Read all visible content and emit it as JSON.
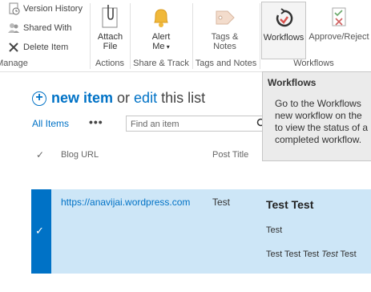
{
  "ribbon": {
    "small_buttons": {
      "version_history": "Version History",
      "shared_with": "Shared With",
      "delete_item": "Delete Item"
    },
    "groups": {
      "manage": "Manage",
      "actions": "Actions",
      "share_track": "Share & Track",
      "tags_notes": "Tags and Notes",
      "workflows": "Workflows"
    },
    "big_buttons": {
      "attach_file_line1": "Attach",
      "attach_file_line2": "File",
      "alert_me_line1": "Alert",
      "alert_me_line2": "Me",
      "tags_notes_line1": "Tags &",
      "tags_notes_line2": "Notes",
      "workflows": "Workflows",
      "approve_reject": "Approve/Reject"
    }
  },
  "tooltip": {
    "title": "Workflows",
    "lines": [
      "Go to the Workflows",
      "new workflow on the",
      "to view the status of a",
      "completed workflow."
    ]
  },
  "list": {
    "new_item": "new item",
    "or": "or",
    "edit": "edit",
    "this_list": "this list",
    "view_label": "All Items",
    "more": "•••",
    "search_placeholder": "Find an item",
    "columns": {
      "blog_url": "Blog URL",
      "post_title": "Post Title"
    },
    "row": {
      "url": "https://anavijai.wordpress.com",
      "title": "Test",
      "body_title": "Test Test",
      "body_line1": "Test",
      "body_line2_a": "Test Test Test ",
      "body_line2_b": "Test",
      "body_line2_c": " Test"
    }
  },
  "colors": {
    "accent": "#0072c6",
    "selected_row": "#cde6f7"
  }
}
